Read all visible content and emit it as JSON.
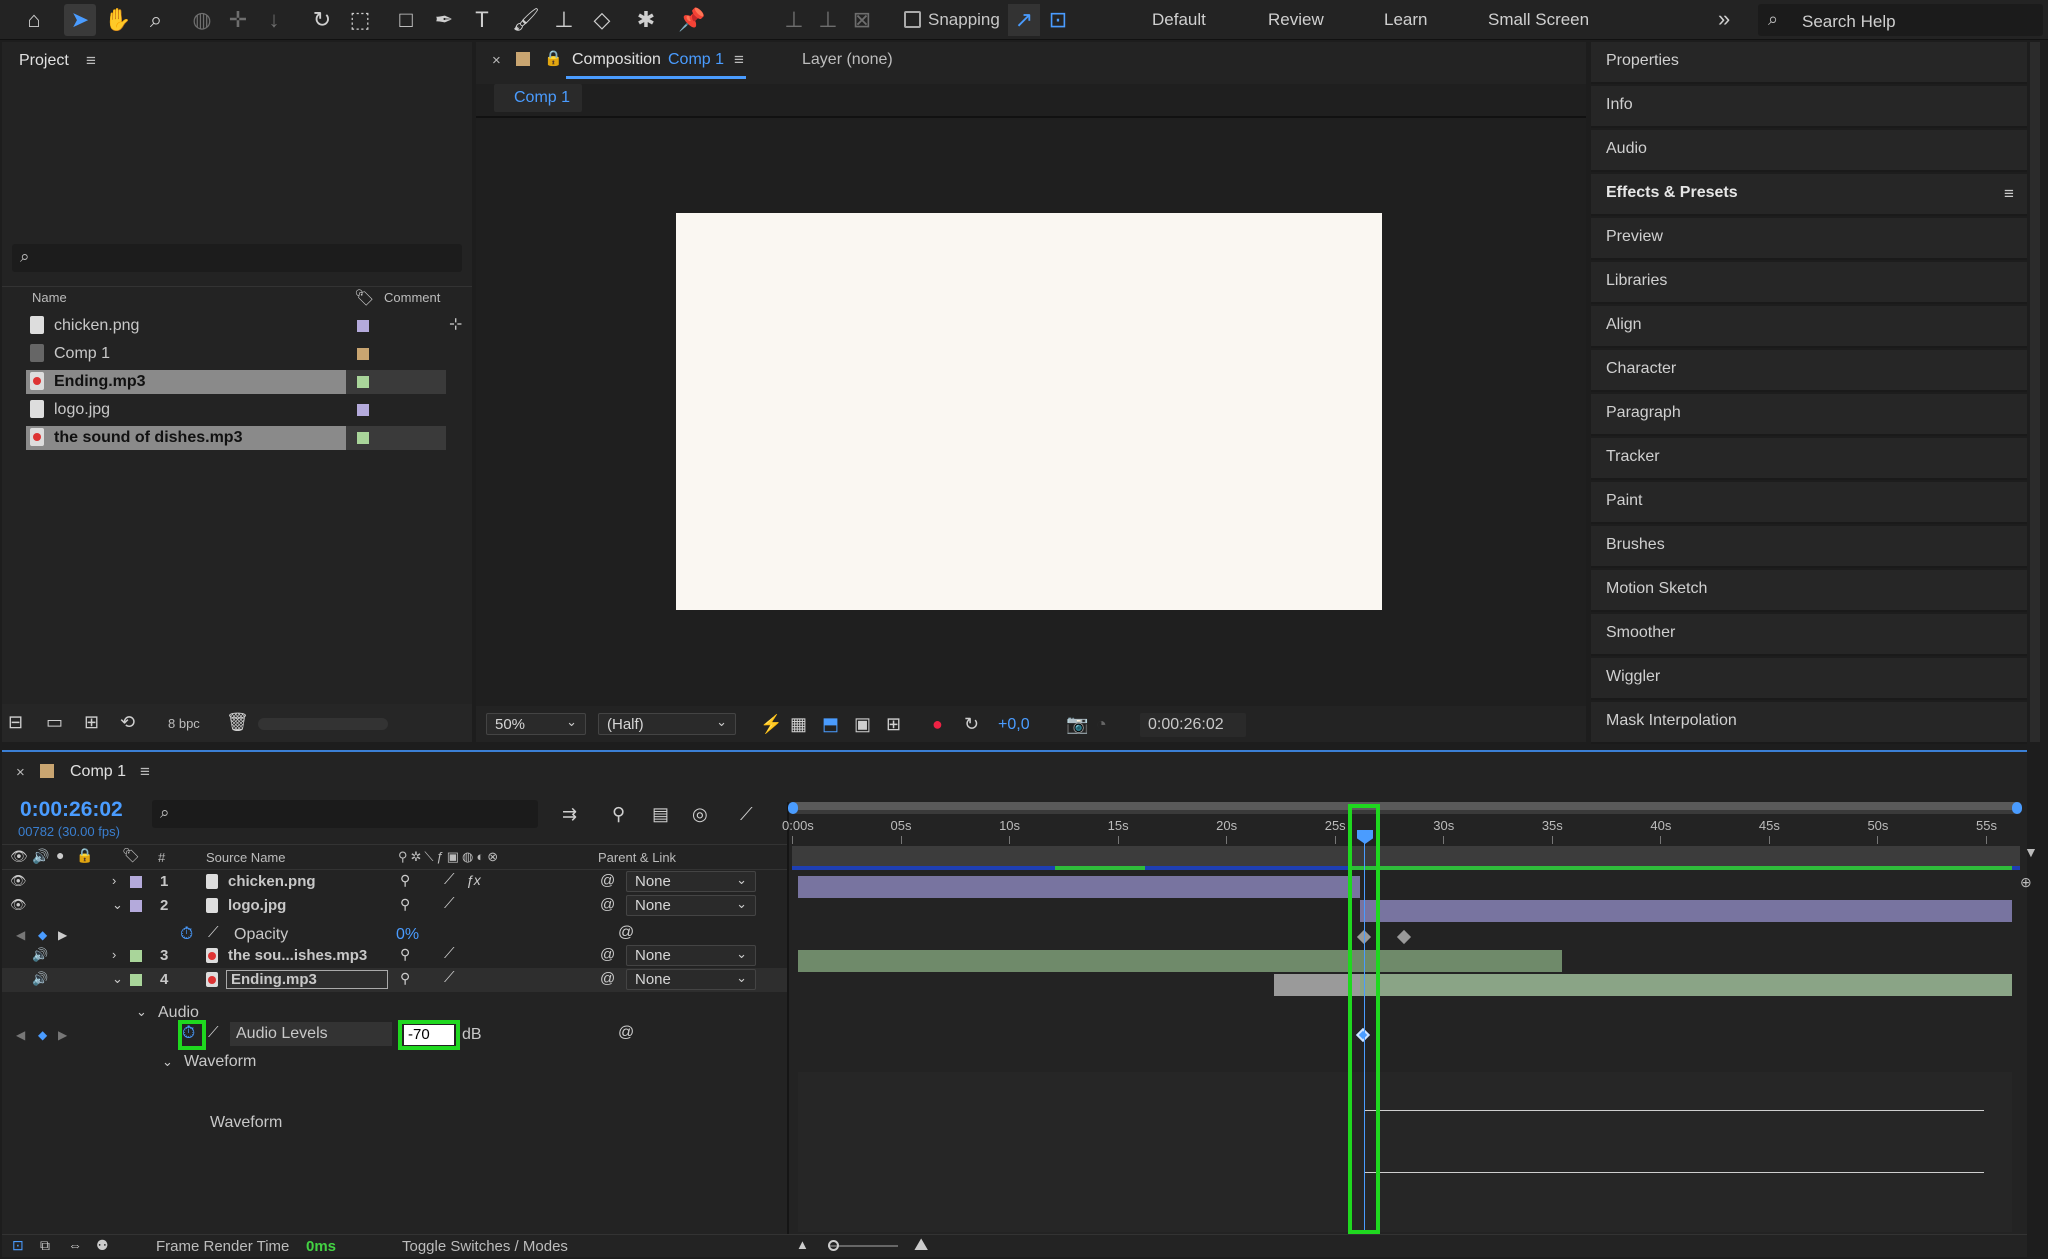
{
  "toolbar": {
    "snapping_label": "Snapping",
    "workspaces": [
      "Default",
      "Review",
      "Learn",
      "Small Screen"
    ],
    "overflow": "»",
    "search_placeholder": "Search Help"
  },
  "project": {
    "title": "Project",
    "col_name": "Name",
    "col_comment": "Comment",
    "items": [
      {
        "name": "chicken.png",
        "kind": "image",
        "color": "#b4aadb",
        "selected": false
      },
      {
        "name": "Comp 1",
        "kind": "comp",
        "color": "#c9a571",
        "selected": false
      },
      {
        "name": "Ending.mp3",
        "kind": "audio",
        "color": "#a9d59a",
        "selected": true
      },
      {
        "name": "logo.jpg",
        "kind": "image",
        "color": "#b4aadb",
        "selected": false
      },
      {
        "name": "the sound of dishes.mp3",
        "kind": "audio",
        "color": "#a9d59a",
        "selected": true
      }
    ],
    "bpc": "8 bpc"
  },
  "viewer": {
    "tab_prefix": "Composition",
    "tab_comp": "Comp 1",
    "layer_tab": "Layer (none)",
    "comp_tab": "Comp 1",
    "zoom": "50%",
    "resolution": "(Half)",
    "exposure": "+0,0",
    "timecode": "0:00:26:02"
  },
  "side": {
    "items": [
      "Properties",
      "Info",
      "Audio",
      "Effects & Presets",
      "Preview",
      "Libraries",
      "Align",
      "Character",
      "Paragraph",
      "Tracker",
      "Paint",
      "Brushes",
      "Motion Sketch",
      "Smoother",
      "Wiggler",
      "Mask Interpolation"
    ]
  },
  "timeline": {
    "tab": "Comp 1",
    "timecode": "0:00:26:02",
    "frame_info": "00782 (30.00 fps)",
    "col_num": "#",
    "col_source": "Source Name",
    "col_parent": "Parent & Link",
    "ruler": [
      "0:00s",
      "05s",
      "10s",
      "15s",
      "20s",
      "25s",
      "30s",
      "35s",
      "40s",
      "45s",
      "50s",
      "55s"
    ],
    "layers": [
      {
        "num": "1",
        "name": "chicken.png",
        "parent": "None",
        "color": "#b4aadb"
      },
      {
        "num": "2",
        "name": "logo.jpg",
        "parent": "None",
        "color": "#b4aadb"
      },
      {
        "num": "3",
        "name": "the sou...ishes.mp3",
        "parent": "None",
        "color": "#a9d59a"
      },
      {
        "num": "4",
        "name": "Ending.mp3",
        "parent": "None",
        "color": "#a9d59a"
      }
    ],
    "opacity_label": "Opacity",
    "opacity_value": "0%",
    "audio_group": "Audio",
    "audio_levels_label": "Audio Levels",
    "audio_levels_value": "-70",
    "audio_levels_unit": "dB",
    "waveform_group": "Waveform",
    "waveform_label": "Waveform",
    "footer": {
      "render_label": "Frame Render Time",
      "render_value": "0ms",
      "toggle_label": "Toggle Switches / Modes"
    }
  }
}
